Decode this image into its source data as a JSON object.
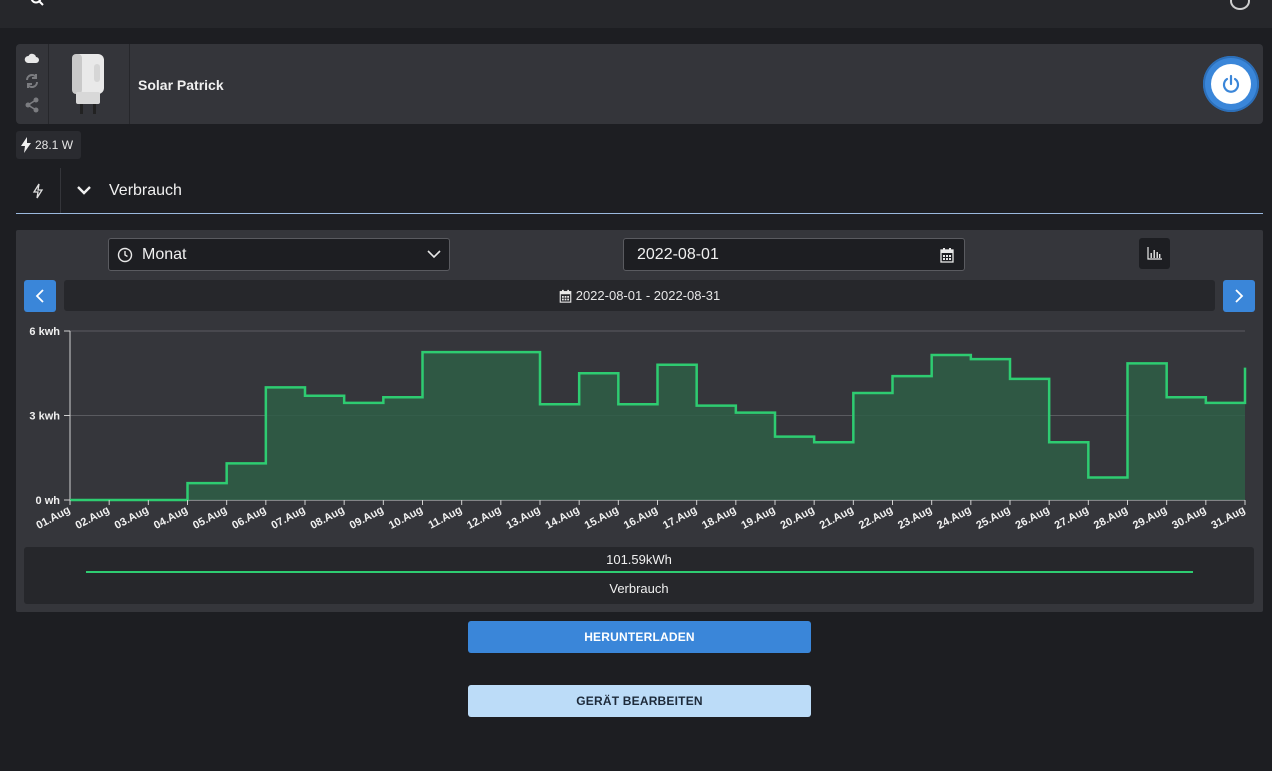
{
  "device": {
    "name": "Solar Patrick",
    "power_badge": "28.1 W"
  },
  "section": {
    "title": "Verbrauch"
  },
  "controls": {
    "period": "Monat",
    "date": "2022-08-01",
    "range": "2022-08-01 - 2022-08-31"
  },
  "summary": {
    "total": "101.59kWh",
    "series_name": "Verbrauch"
  },
  "buttons": {
    "download": "HERUNTERLADEN",
    "edit": "GERÄT BEARBEITEN"
  },
  "colors": {
    "accent": "#3a86d9",
    "series": "#2ecc71",
    "area": "#2e5e46"
  },
  "icons": [
    "cloud-icon",
    "sync-icon",
    "share-icon",
    "plug-image",
    "power-icon",
    "lightning-icon",
    "chevron-down-icon",
    "clock-icon",
    "calendar-icon",
    "bar-chart-icon",
    "chevron-left-icon",
    "chevron-right-icon"
  ],
  "chart_data": {
    "type": "area",
    "step": true,
    "categories": [
      "01.Aug",
      "02.Aug",
      "03.Aug",
      "04.Aug",
      "05.Aug",
      "06.Aug",
      "07.Aug",
      "08.Aug",
      "09.Aug",
      "10.Aug",
      "11.Aug",
      "12.Aug",
      "13.Aug",
      "14.Aug",
      "15.Aug",
      "16.Aug",
      "17.Aug",
      "18.Aug",
      "19.Aug",
      "20.Aug",
      "21.Aug",
      "22.Aug",
      "23.Aug",
      "24.Aug",
      "25.Aug",
      "26.Aug",
      "27.Aug",
      "28.Aug",
      "29.Aug",
      "30.Aug",
      "31.Aug"
    ],
    "series": [
      {
        "name": "Verbrauch",
        "values": [
          0,
          0,
          0,
          0.6,
          1.3,
          4.0,
          3.7,
          3.45,
          3.65,
          5.25,
          5.25,
          5.25,
          3.4,
          4.5,
          3.4,
          4.8,
          3.35,
          3.1,
          2.25,
          2.05,
          3.8,
          4.4,
          5.15,
          5.0,
          4.3,
          2.05,
          0.8,
          4.85,
          3.65,
          3.45,
          4.7
        ]
      }
    ],
    "ylim": [
      0,
      6
    ],
    "y_ticks": [
      {
        "value": 0,
        "label": "0 wh"
      },
      {
        "value": 3,
        "label": "3 kwh"
      },
      {
        "value": 6,
        "label": "6 kwh"
      }
    ],
    "grid": true
  }
}
